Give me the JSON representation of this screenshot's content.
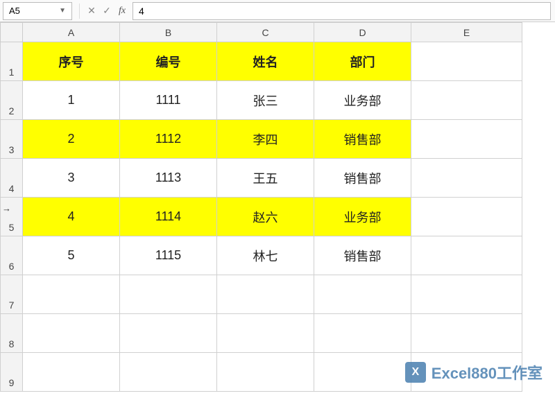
{
  "nameBox": {
    "ref": "A5"
  },
  "formulaBar": {
    "value": "4"
  },
  "columns": [
    "A",
    "B",
    "C",
    "D",
    "E"
  ],
  "colWidths": {
    "A": 140,
    "B": 140,
    "C": 140,
    "D": 140,
    "E": 160
  },
  "rows": [
    1,
    2,
    3,
    4,
    5,
    6,
    7,
    8,
    9
  ],
  "activeRow": 5,
  "headerRow": {
    "highlight": true,
    "cells": [
      "序号",
      "编号",
      "姓名",
      "部门"
    ]
  },
  "dataRows": [
    {
      "highlight": false,
      "cells": [
        "1",
        "1111",
        "张三",
        "业务部"
      ]
    },
    {
      "highlight": true,
      "cells": [
        "2",
        "1112",
        "李四",
        "销售部"
      ]
    },
    {
      "highlight": false,
      "cells": [
        "3",
        "1113",
        "王五",
        "销售部"
      ]
    },
    {
      "highlight": true,
      "cells": [
        "4",
        "1114",
        "赵六",
        "业务部"
      ]
    },
    {
      "highlight": false,
      "cells": [
        "5",
        "1115",
        "林七",
        "销售部"
      ]
    }
  ],
  "emptyRows": 3,
  "watermark": {
    "iconText": "X",
    "text": "Excel880工作室"
  }
}
